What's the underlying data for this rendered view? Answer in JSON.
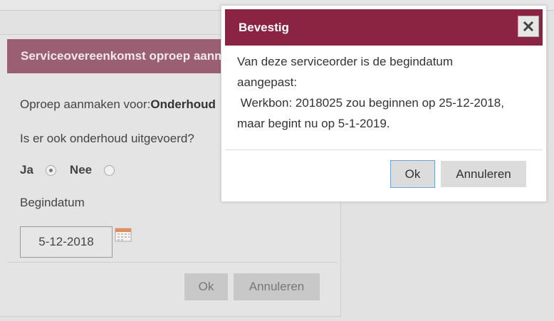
{
  "background_dialog": {
    "title": "Serviceovereenkomst oproep aanmaken",
    "create_call_label": "Oproep aanmaken voor:",
    "create_call_value": "Onderhoud",
    "maintenance_question": "Is er ook onderhoud uitgevoerd?",
    "radio_yes_label": "Ja",
    "radio_no_label": "Nee",
    "selected_option": "Ja",
    "start_date_label": "Begindatum",
    "start_date_value": "5-12-2018",
    "ok_label": "Ok",
    "cancel_label": "Annuleren"
  },
  "confirm_dialog": {
    "title": "Bevestig",
    "message_lines": [
      "Van deze serviceorder is de begindatum",
      "aangepast:",
      " Werkbon: 2018025 zou beginnen op 25-12-2018,",
      "maar begint nu op 5-1-2019."
    ],
    "ok_label": "Ok",
    "cancel_label": "Annuleren",
    "close_icon": "close-icon"
  },
  "colors": {
    "header_active": "#8b2342",
    "header_inactive": "#9a5f72",
    "focus_border": "#6aa5e0"
  }
}
